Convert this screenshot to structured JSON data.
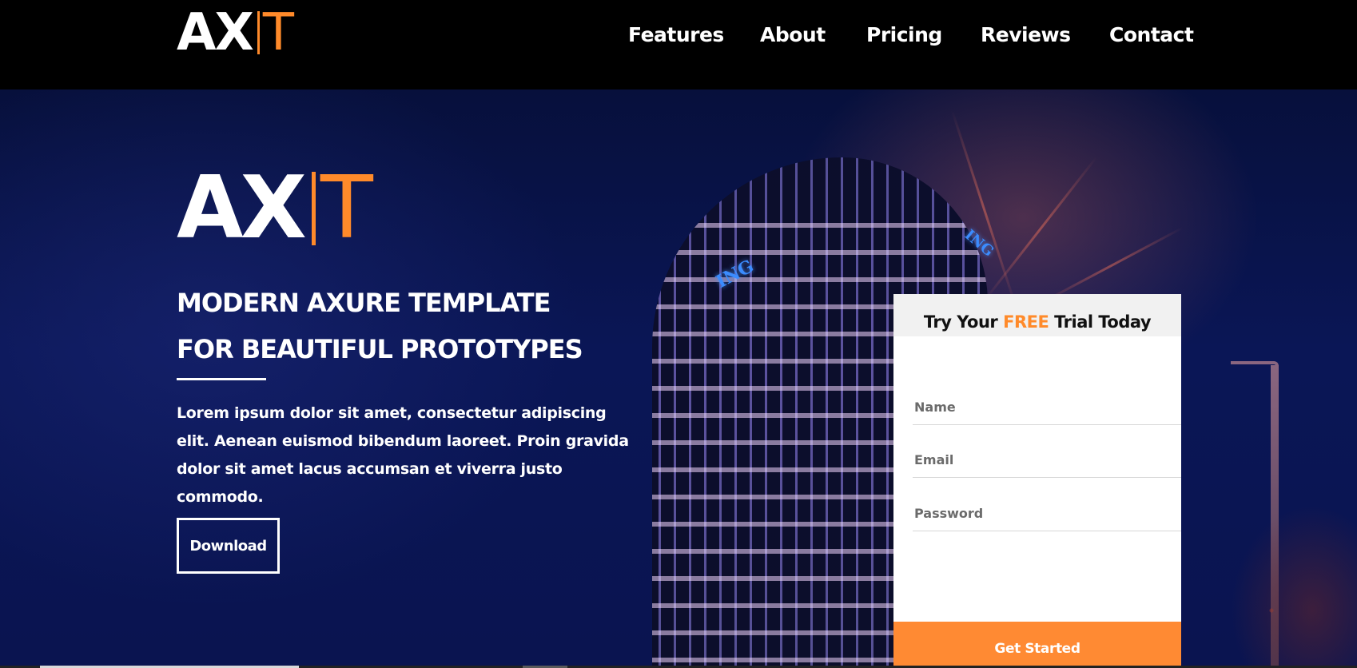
{
  "brand": {
    "logo_ax": "AX",
    "logo_t": "T",
    "accent_color": "#ff8a2a"
  },
  "nav": {
    "items": [
      {
        "label": "Features"
      },
      {
        "label": "About"
      },
      {
        "label": "Pricing"
      },
      {
        "label": "Reviews"
      },
      {
        "label": "Contact"
      }
    ]
  },
  "hero": {
    "logo_ax": "AX",
    "logo_t": "T",
    "headline_line1": "MODERN AXURE TEMPLATE",
    "headline_line2": "FOR BEAUTIFUL PROTOTYPES",
    "description": "Lorem ipsum dolor sit amet, consectetur adipiscing elit. Aenean euismod bibendum laoreet. Proin gravida dolor sit amet lacus accumsan et viverra justo commodo.",
    "download_label": "Download",
    "sign_text": "ING"
  },
  "trial_form": {
    "title_prefix": "Try Your ",
    "title_highlight": "FREE",
    "title_suffix": " Trial Today",
    "name_placeholder": "Name",
    "email_placeholder": "Email",
    "password_placeholder": "Password",
    "submit_label": "Get Started",
    "button_color": "#ff8a33"
  }
}
